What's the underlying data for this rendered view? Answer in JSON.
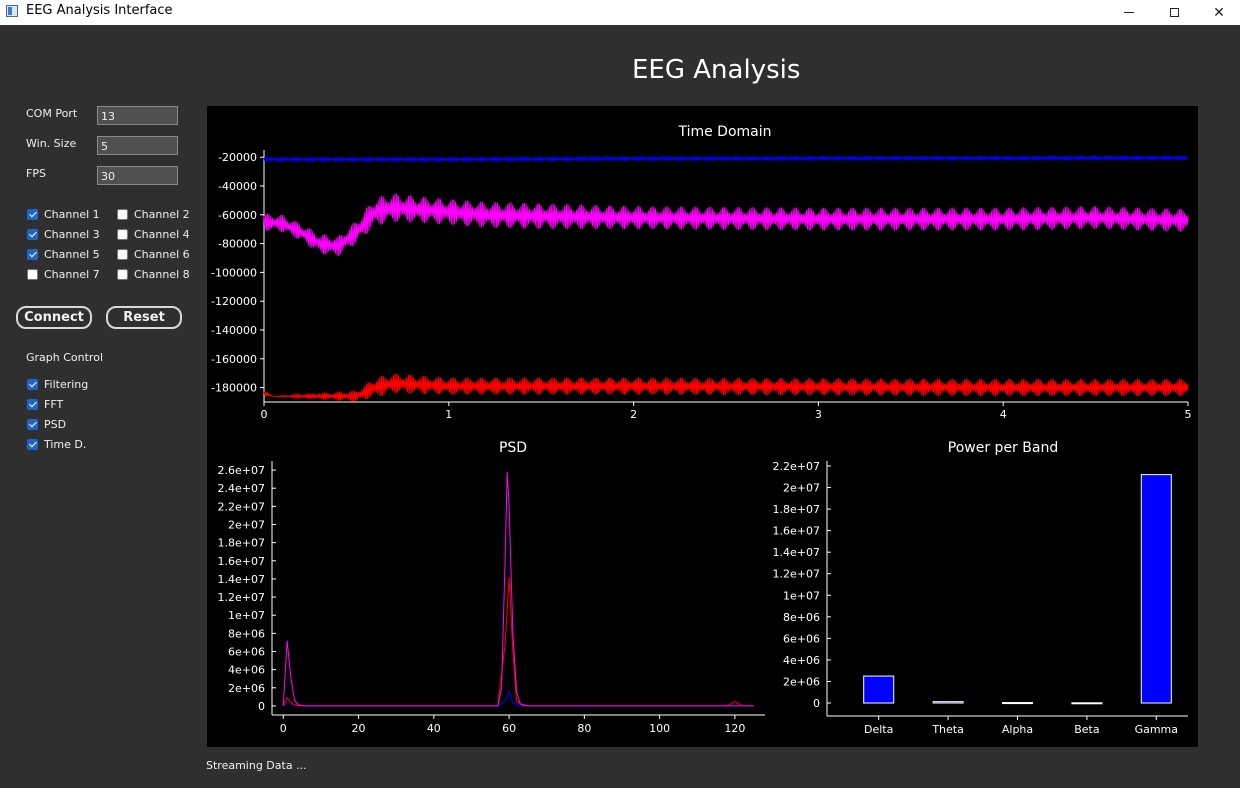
{
  "window": {
    "title": "EEG Analysis Interface",
    "min_glyph": "",
    "max_glyph": "",
    "close_glyph": "✕"
  },
  "heading": "EEG Analysis",
  "controls": {
    "com_port": {
      "label": "COM Port",
      "value": "13"
    },
    "win_size": {
      "label": "Win. Size",
      "value": "5"
    },
    "fps": {
      "label": "FPS",
      "value": "30"
    },
    "channels": [
      {
        "label": "Channel 1",
        "checked": true
      },
      {
        "label": "Channel 2",
        "checked": false
      },
      {
        "label": "Channel 3",
        "checked": true
      },
      {
        "label": "Channel 4",
        "checked": false
      },
      {
        "label": "Channel 5",
        "checked": true
      },
      {
        "label": "Channel 6",
        "checked": false
      },
      {
        "label": "Channel 7",
        "checked": false
      },
      {
        "label": "Channel 8",
        "checked": false
      }
    ],
    "connect_label": "Connect",
    "reset_label": "Reset",
    "graph_control_label": "Graph Control",
    "graph_options": [
      {
        "label": "Filtering",
        "checked": true
      },
      {
        "label": "FFT",
        "checked": true
      },
      {
        "label": "PSD",
        "checked": true
      },
      {
        "label": "Time D.",
        "checked": true
      }
    ]
  },
  "status": "Streaming Data ...",
  "colors": {
    "ch1": "#0000ff",
    "ch3": "#ff00ff",
    "ch5": "#ff0000",
    "bar": "#0000ff",
    "axis": "#ffffff",
    "plot_bg": "#000000"
  },
  "chart_data": [
    {
      "type": "line",
      "title": "Time Domain",
      "xlim": [
        0,
        5
      ],
      "ylim": [
        -190000,
        -15000
      ],
      "xticks": [
        "0",
        "1",
        "2",
        "3",
        "4",
        "5"
      ],
      "yticks": [
        "-20000",
        "-40000",
        "-60000",
        "-80000",
        "-100000",
        "-120000",
        "-140000",
        "-160000",
        "-180000"
      ],
      "series": [
        {
          "color": "#0000ff",
          "x": [
            0,
            1,
            2,
            3,
            4,
            5
          ],
          "center": [
            -21500,
            -21500,
            -21000,
            -20800,
            -20700,
            -20500
          ],
          "band": [
            3000,
            3000,
            3000,
            3000,
            3000,
            3000
          ]
        },
        {
          "color": "#ff00ff",
          "x": [
            0,
            0.1,
            0.2,
            0.3,
            0.4,
            0.5,
            0.6,
            0.7,
            0.9,
            1.2,
            1.5,
            2,
            3,
            4,
            4.5,
            5
          ],
          "center": [
            -65000,
            -66000,
            -72000,
            -80000,
            -82000,
            -72000,
            -58000,
            -55000,
            -57000,
            -60000,
            -61000,
            -62000,
            -63000,
            -63000,
            -62000,
            -64000
          ],
          "band": [
            12000,
            12000,
            12000,
            14000,
            14000,
            16000,
            20000,
            20000,
            18000,
            18000,
            18000,
            16000,
            16000,
            16000,
            16000,
            16000
          ]
        },
        {
          "color": "#ff0000",
          "x": [
            0,
            0.05,
            0.5,
            0.6,
            0.7,
            1,
            2,
            3,
            4,
            5
          ],
          "center": [
            -184000,
            -186000,
            -186000,
            -180000,
            -177000,
            -179000,
            -179000,
            -179500,
            -180000,
            -180000
          ],
          "band": [
            3000,
            0,
            8000,
            14000,
            14000,
            12000,
            12000,
            12000,
            12000,
            12000
          ]
        }
      ]
    },
    {
      "type": "line",
      "title": "PSD",
      "xlim": [
        -3,
        128
      ],
      "ylim": [
        -1000000,
        27000000
      ],
      "xticks": [
        "0",
        "20",
        "40",
        "60",
        "80",
        "100",
        "120"
      ],
      "yticks": [
        "0",
        "2e+06",
        "4e+06",
        "6e+06",
        "8e+06",
        "1e+07",
        "1.2e+07",
        "1.4e+07",
        "1.6e+07",
        "1.8e+07",
        "2e+07",
        "2.2e+07",
        "2.4e+07",
        "2.6e+07"
      ],
      "series": [
        {
          "color": "#0000ff",
          "x": [
            0,
            1,
            2,
            3,
            5,
            10,
            57,
            59,
            60,
            61,
            63,
            120,
            125
          ],
          "y": [
            0,
            400000,
            200000,
            50000,
            0,
            0,
            0,
            500000,
            1600000,
            300000,
            0,
            0,
            0
          ]
        },
        {
          "color": "#ff0000",
          "x": [
            0,
            1,
            2,
            3,
            5,
            10,
            57,
            59,
            60,
            61,
            62,
            64,
            70,
            72,
            118,
            120,
            122,
            125
          ],
          "y": [
            0,
            900000,
            400000,
            80000,
            0,
            0,
            0,
            7000000,
            14200000,
            6000000,
            500000,
            0,
            0,
            0,
            0,
            500000,
            0,
            0
          ]
        },
        {
          "color": "#ff00ff",
          "x": [
            0,
            1,
            2,
            3,
            4,
            6,
            10,
            57,
            58,
            59,
            59.5,
            60,
            61,
            62,
            63,
            65,
            125
          ],
          "y": [
            0,
            7200000,
            3200000,
            600000,
            100000,
            0,
            0,
            0,
            2000000,
            17000000,
            25800000,
            22000000,
            8000000,
            1500000,
            200000,
            0,
            0
          ]
        }
      ]
    },
    {
      "type": "bar",
      "title": "Power per Band",
      "categories": [
        "Delta",
        "Theta",
        "Alpha",
        "Beta",
        "Gamma"
      ],
      "values": [
        2500000,
        120000,
        40000,
        20000,
        21200000
      ],
      "ylim": [
        0,
        22000000
      ],
      "yticks": [
        "0",
        "2e+06",
        "4e+06",
        "6e+06",
        "8e+06",
        "1e+07",
        "1.2e+07",
        "1.4e+07",
        "1.6e+07",
        "1.8e+07",
        "2e+07",
        "2.2e+07"
      ]
    }
  ]
}
